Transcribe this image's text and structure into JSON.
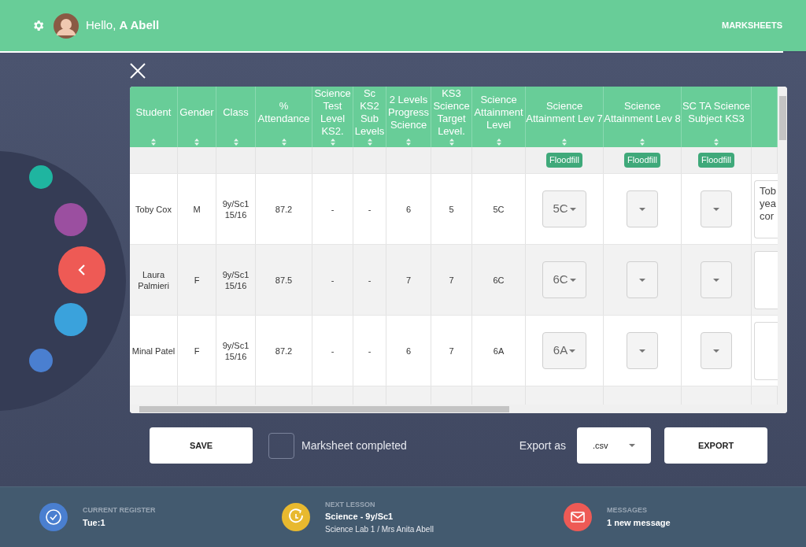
{
  "header": {
    "greeting": "Hello, **A Abell**",
    "nav": "MARKSHEETS"
  },
  "table": {
    "columns": [
      {
        "kind": "text",
        "label": "Student"
      },
      {
        "kind": "text",
        "label": "Gender"
      },
      {
        "kind": "text",
        "label": "Class"
      },
      {
        "kind": "text",
        "label": "% Attendance"
      },
      {
        "kind": "text",
        "label": "Science Test Level KS2."
      },
      {
        "kind": "text",
        "label": "Sc KS2 Sub Levels"
      },
      {
        "kind": "text",
        "label": "2 Levels Progress Science"
      },
      {
        "kind": "text",
        "label": "KS3 Science Target Level."
      },
      {
        "kind": "text",
        "label": "Science Attainment Level"
      },
      {
        "kind": "select",
        "label": "Science Attainment Lev 7",
        "floodfill": "Floodfill"
      },
      {
        "kind": "select",
        "label": "Science Attainment Lev 8",
        "floodfill": "Floodfill"
      },
      {
        "kind": "select",
        "label": "SC TA Science Subject KS3",
        "floodfill": "Floodfill"
      },
      {
        "kind": "comment"
      }
    ],
    "rows": [
      {
        "kind": "student",
        "cells": [
          "Toby Cox",
          "M",
          "9y/Sc1 15/16",
          "87.2",
          "-",
          "-",
          "6",
          "5",
          "5C"
        ],
        "attainment_lev_7": "5C",
        "comment": "Tob yea cor"
      },
      {
        "kind": "student",
        "cells": [
          "Laura Palmieri",
          "F",
          "9y/Sc1 15/16",
          "87.5",
          "-",
          "-",
          "7",
          "7",
          "6C"
        ],
        "attainment_lev_7": "6C"
      },
      {
        "kind": "student",
        "cells": [
          "Minal Patel",
          "F",
          "9y/Sc1 15/16",
          "87.2",
          "-",
          "-",
          "6",
          "7",
          "6A"
        ],
        "attainment_lev_7": "6A"
      },
      {
        "kind": "partial"
      }
    ]
  },
  "actions": {
    "save": "SAVE",
    "completed": {
      "label": "Marksheet completed",
      "checked": false
    },
    "export_label": "Export as",
    "export_format": ".csv",
    "export": "EXPORT"
  },
  "footer": [
    {
      "kind": "register",
      "label": "CURRENT REGISTER",
      "value": "Tue:1"
    },
    {
      "kind": "lesson",
      "label": "NEXT LESSON",
      "value": "Science - 9y/Sc1",
      "detail": "Science Lab 1 / Mrs Anita Abell"
    },
    {
      "kind": "messages",
      "label": "MESSAGES",
      "value": "1 new message"
    }
  ]
}
